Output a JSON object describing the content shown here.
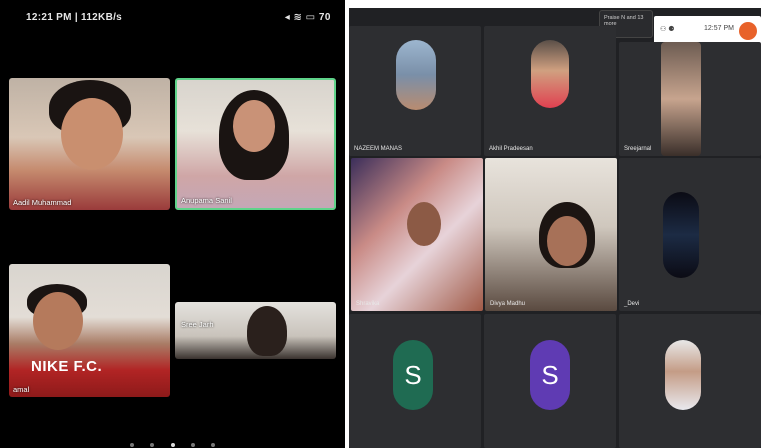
{
  "phone": {
    "status_left": "12:21 PM | 112KB/s",
    "status_right": "70",
    "tiles": [
      {
        "name": "Aadil Muhammad"
      },
      {
        "name": "Anupama Sanil"
      },
      {
        "name": "amal"
      },
      {
        "name": "Sree Jarh"
      }
    ],
    "shirt_text": "NIKE F.C.",
    "page_dots": 5,
    "active_dot": 2
  },
  "meet": {
    "presenting_label": "Praise N and 13 more",
    "clock": "12:57 PM",
    "participants": [
      {
        "name": "NAZEEM MANAS"
      },
      {
        "name": "Akhil Pradeesan"
      },
      {
        "name": "Sreejarnal"
      },
      {
        "name": "Shravika"
      },
      {
        "name": "Divya Madhu"
      },
      {
        "name": "_Devi"
      },
      {
        "name": "",
        "letter": "S"
      },
      {
        "name": "",
        "letter": "S"
      },
      {
        "name": ""
      }
    ],
    "colors": {
      "avatar_green": "#1f6b52",
      "avatar_purple": "#5f3bb3",
      "record_orange": "#e8622a",
      "background": "#202124"
    }
  }
}
